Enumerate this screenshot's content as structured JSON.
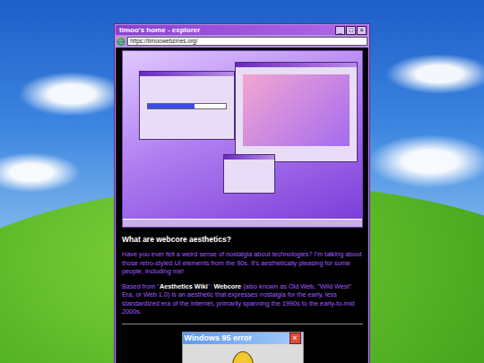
{
  "window": {
    "title": "timoo's home - explorer",
    "controls": [
      "_",
      "□",
      "×"
    ]
  },
  "address_bar": {
    "url": "https://timoowebzines.org/"
  },
  "article": {
    "heading": "What are webcore aesthetics?",
    "paragraphs": [
      [
        {
          "text": "Have you ever felt a weird sense of nostalgia about technologies? I'm talking about those retro-styled UI elements from the 90s. It's aesthetically pleasing for some people, including me!",
          "emphasis": false
        }
      ],
      [
        {
          "text": "Based from \"",
          "emphasis": false
        },
        {
          "text": "Aesthetics Wiki",
          "emphasis": true
        },
        {
          "text": "\": ",
          "emphasis": false
        },
        {
          "text": "Webcore",
          "emphasis": true
        },
        {
          "text": " (also known as Old Web, \"Wild West\" Era, or Web 1.0) is an aesthetic that expresses nostalgia for the early, less standardized era of the Internet, primarily spanning the 1990s to the early-to-mid 2000s.",
          "emphasis": false
        }
      ]
    ]
  },
  "error_dialog": {
    "title": "Windows 95 error",
    "close": "×"
  }
}
